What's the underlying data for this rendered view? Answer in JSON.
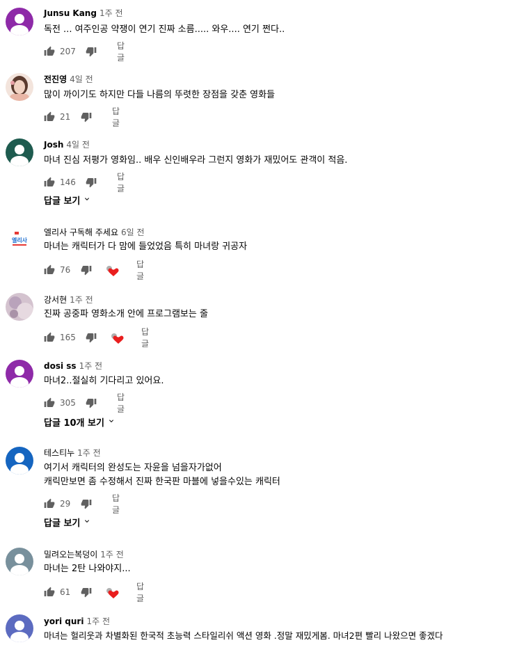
{
  "comments": [
    {
      "author": "Junsu Kang",
      "time": "1주 전",
      "text": [
        "독전 ... 여주인공 약쟁이 연기 진짜 소름..... 와우.... 연기 쩐다.."
      ],
      "likes": "207",
      "reply": "답글",
      "avatar_color": "#8e2aa8"
    },
    {
      "author": "전진영",
      "time": "4일 전",
      "text": [
        "많이 까이기도 하지만 다들 나름의 뚜렷한 장점을 갖춘 영화들"
      ],
      "likes": "21",
      "reply": "답글",
      "avatar_color": "#e8c7b8"
    },
    {
      "author": "Josh",
      "time": "4일 전",
      "text": [
        "마녀 진심 저평가 영화임.. 배우 신인배우라 그런지 영화가 재밌어도 관객이 적음."
      ],
      "likes": "146",
      "reply": "답글",
      "replies_label": "답글 보기",
      "avatar_color": "#1e5b4f"
    },
    {
      "author": "엘리사 구독해 주세요",
      "time": "6일 전",
      "text": [
        "마녀는 캐릭터가 다 맘에 들었었음 특히 마녀랑 귀공자"
      ],
      "likes": "76",
      "reply": "답글",
      "hearted": true,
      "avatar_color": "#ffffff",
      "avatar_label": "엘리사"
    },
    {
      "author": "강서현",
      "time": "1주 전",
      "text": [
        "진짜 공중파 영화소개 안에 프로그램보는 줄"
      ],
      "likes": "165",
      "reply": "답글",
      "hearted": true,
      "avatar_color": "#c9b7c4"
    },
    {
      "author": "dosi ss",
      "time": "1주 전",
      "text": [
        "마녀2..절실히 기다리고 있어요."
      ],
      "likes": "305",
      "reply": "답글",
      "replies_label": "답글 10개 보기",
      "avatar_color": "#8e2aa8"
    },
    {
      "author": "테스티누",
      "time": "1주 전",
      "text": [
        "여기서 캐릭터의  완성도는 자윤을 넘을자가없어",
        "캐릭만보면 좀 수정해서 진짜 한국판 마블에 넣을수있는 캐릭터"
      ],
      "likes": "29",
      "reply": "답글",
      "replies_label": "답글 보기",
      "avatar_color": "#1565c0"
    },
    {
      "author": "밀려오는복덩이",
      "time": "1주 전",
      "text": [
        "마녀는 2탄 나와야지..."
      ],
      "likes": "61",
      "reply": "답글",
      "hearted": true,
      "avatar_color": "#78909c"
    },
    {
      "author": "yori quri",
      "time": "1주 전",
      "text": [
        "마녀는 헐리웃과 차별화된 한국적 초능력 스타일리쉬 액션 영화 .정말 재밌게봄. 마녀2편 빨리 나왔으면 좋겠다"
      ],
      "likes": "",
      "reply": "",
      "avatar_color": "#5c6bc0"
    }
  ]
}
